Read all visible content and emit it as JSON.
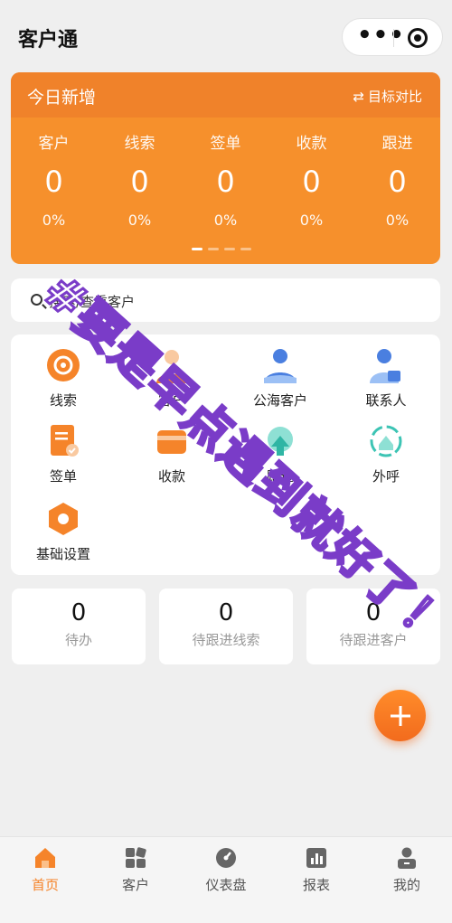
{
  "app": {
    "title": "客户通"
  },
  "capsule": {
    "more_icon": "more-dots-icon",
    "close_icon": "target-circle-icon"
  },
  "stats": {
    "title": "今日新增",
    "compare_label": "目标对比",
    "compare_icon": "swap-icon",
    "items": [
      {
        "label": "客户",
        "value": "0",
        "percent": "0%"
      },
      {
        "label": "线索",
        "value": "0",
        "percent": "0%"
      },
      {
        "label": "签单",
        "value": "0",
        "percent": "0%"
      },
      {
        "label": "收款",
        "value": "0",
        "percent": "0%"
      },
      {
        "label": "跟进",
        "value": "0",
        "percent": "0%"
      }
    ],
    "pager": {
      "count": 4,
      "active": 0
    },
    "colors": {
      "card": "#f6902c",
      "header": "#f0822a"
    }
  },
  "search": {
    "placeholder": "搜索/查重客户"
  },
  "menu": [
    {
      "label": "线索",
      "icon": "leads-icon"
    },
    {
      "label": "客户",
      "icon": "customer-icon"
    },
    {
      "label": "公海客户",
      "icon": "public-customer-icon"
    },
    {
      "label": "联系人",
      "icon": "contact-icon"
    },
    {
      "label": "签单",
      "icon": "contract-icon"
    },
    {
      "label": "收款",
      "icon": "payment-icon"
    },
    {
      "label": "跟进",
      "icon": "follow-up-icon"
    },
    {
      "label": "外呼",
      "icon": "outbound-call-icon"
    },
    {
      "label": "基础设置",
      "icon": "settings-icon"
    }
  ],
  "summary": [
    {
      "value": "0",
      "label": "待办"
    },
    {
      "value": "0",
      "label": "待跟进线索"
    },
    {
      "value": "0",
      "label": "待跟进客户"
    }
  ],
  "fab": {
    "icon": "plus-icon"
  },
  "tabs": [
    {
      "label": "首页",
      "icon": "home-icon",
      "active": true
    },
    {
      "label": "客户",
      "icon": "grid-icon",
      "active": false
    },
    {
      "label": "仪表盘",
      "icon": "dashboard-icon",
      "active": false
    },
    {
      "label": "报表",
      "icon": "bar-chart-icon",
      "active": false
    },
    {
      "label": "我的",
      "icon": "profile-icon",
      "active": false
    }
  ],
  "watermark": {
    "text": "#要是早点遇到就好了！"
  },
  "colors": {
    "accent": "#f5842a",
    "blue": "#4a7fe0",
    "teal": "#3cc4b4"
  }
}
